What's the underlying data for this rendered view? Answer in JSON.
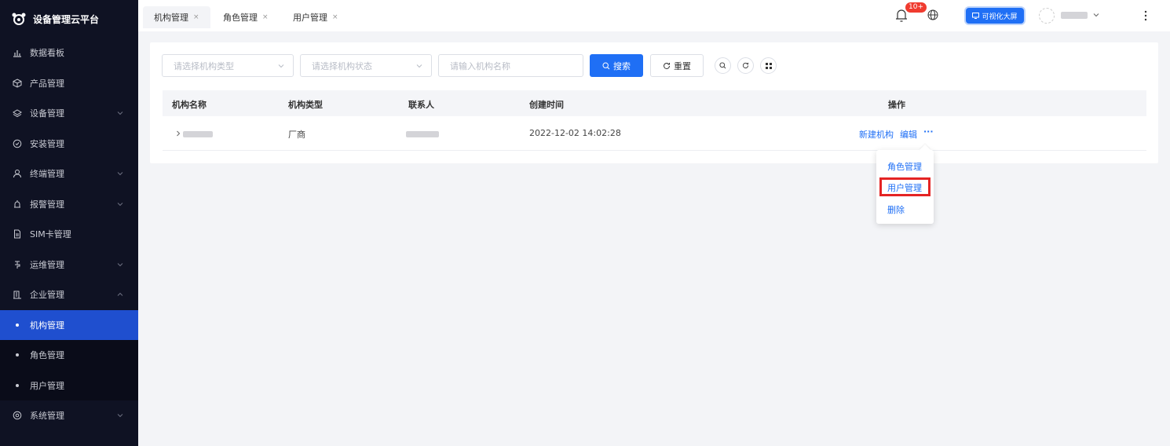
{
  "app": {
    "title": "设备管理云平台"
  },
  "sidebar": {
    "items": [
      {
        "label": "数据看板",
        "icon": "bar-chart-icon",
        "expandable": false
      },
      {
        "label": "产品管理",
        "icon": "cube-icon",
        "expandable": false
      },
      {
        "label": "设备管理",
        "icon": "layers-icon",
        "expandable": true
      },
      {
        "label": "安装管理",
        "icon": "gear-circle-icon",
        "expandable": false
      },
      {
        "label": "终端管理",
        "icon": "user-icon",
        "expandable": true
      },
      {
        "label": "报警管理",
        "icon": "alarm-icon",
        "expandable": true
      },
      {
        "label": "SIM卡管理",
        "icon": "sim-card-icon",
        "expandable": false
      },
      {
        "label": "运维管理",
        "icon": "tool-icon",
        "expandable": true
      },
      {
        "label": "企业管理",
        "icon": "building-icon",
        "expandable": true,
        "expanded": true
      }
    ],
    "sub_items": [
      {
        "label": "机构管理",
        "active": true
      },
      {
        "label": "角色管理",
        "active": false
      },
      {
        "label": "用户管理",
        "active": false
      }
    ],
    "last_item": {
      "label": "系统管理",
      "icon": "settings-icon",
      "expandable": true
    }
  },
  "tabs": [
    {
      "label": "机构管理",
      "close": "×",
      "active": true
    },
    {
      "label": "角色管理",
      "close": "×",
      "active": false
    },
    {
      "label": "用户管理",
      "close": "×",
      "active": false
    }
  ],
  "header": {
    "notification_badge": "10+",
    "bigscreen_label": "可视化大屏"
  },
  "filters": {
    "type_placeholder": "请选择机构类型",
    "status_placeholder": "请选择机构状态",
    "name_placeholder": "请输入机构名称",
    "search_label": "搜索",
    "reset_label": "重置"
  },
  "table": {
    "columns": [
      "机构名称",
      "机构类型",
      "联系人",
      "创建时间",
      "操作"
    ],
    "rows": [
      {
        "type": "厂商",
        "created": "2022-12-02 14:02:28",
        "actions": [
          "新建机构",
          "编辑",
          "···"
        ]
      }
    ]
  },
  "dropdown": {
    "items": [
      "角色管理",
      "用户管理",
      "删除"
    ]
  },
  "colors": {
    "primary": "#1f6ff5",
    "sidebar_bg": "#0f1223",
    "active_menu": "#1f4fcf",
    "highlight": "#e42424"
  }
}
